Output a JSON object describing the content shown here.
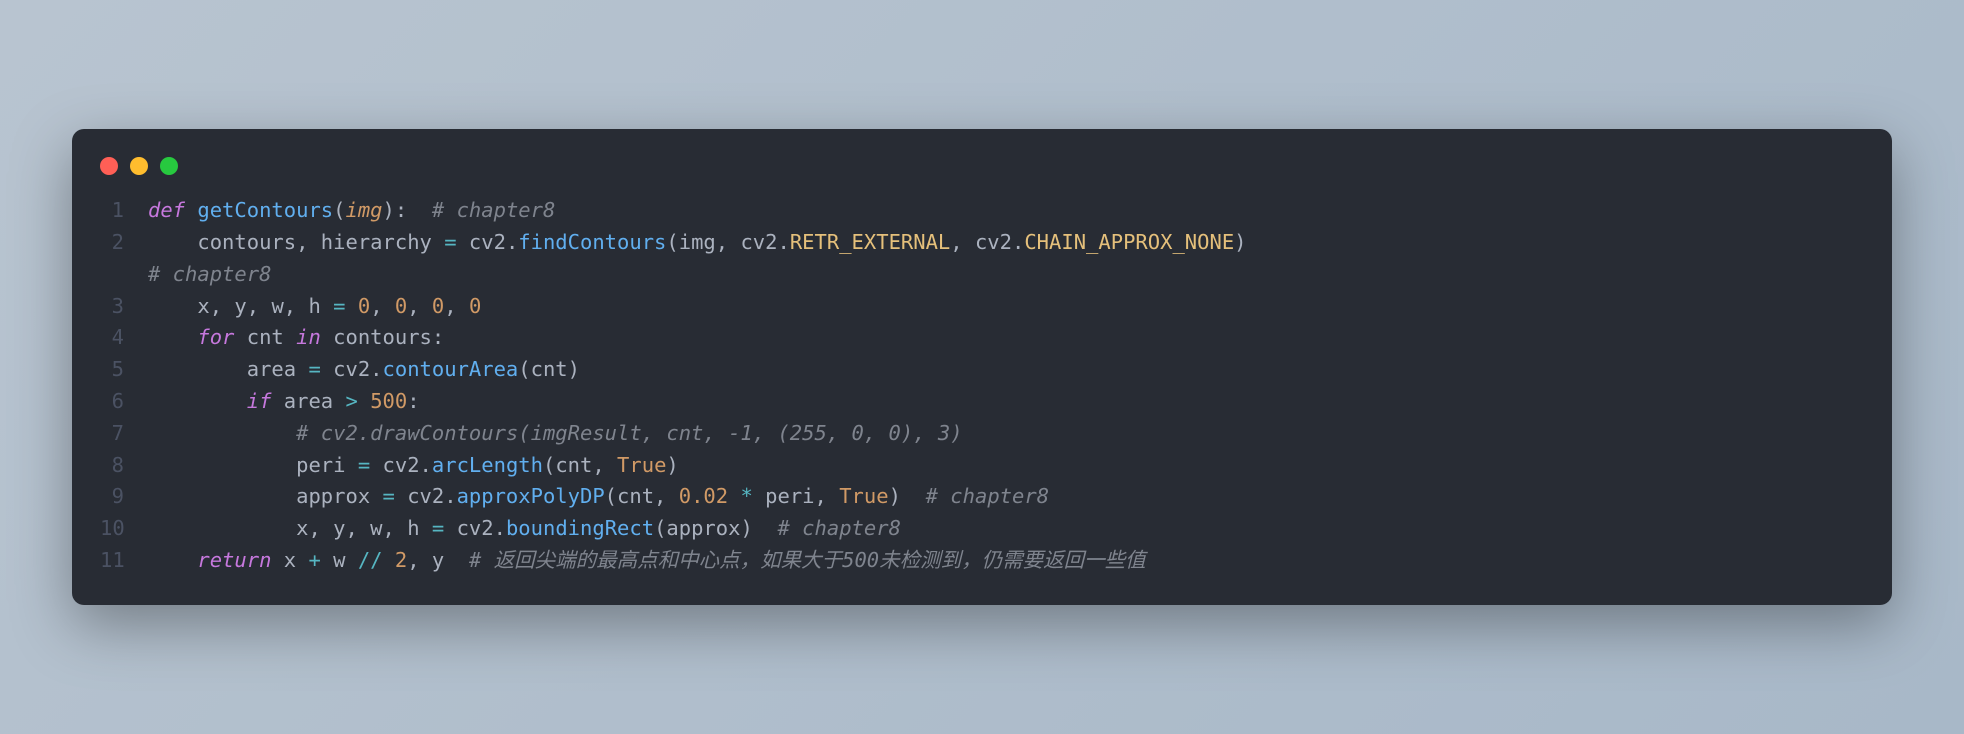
{
  "window": {
    "dots": [
      "red",
      "yellow",
      "green"
    ]
  },
  "lines": [
    {
      "num": "1",
      "tokens": [
        [
          "kw",
          "def "
        ],
        [
          "fn",
          "getContours"
        ],
        [
          "punct",
          "("
        ],
        [
          "param",
          "img"
        ],
        [
          "punct",
          "):  "
        ],
        [
          "comment",
          "# chapter8"
        ]
      ]
    },
    {
      "num": "2",
      "tokens": [
        [
          "ident",
          "    contours"
        ],
        [
          "punct",
          ", "
        ],
        [
          "ident",
          "hierarchy "
        ],
        [
          "op",
          "= "
        ],
        [
          "ident",
          "cv2"
        ],
        [
          "punct",
          "."
        ],
        [
          "fn",
          "findContours"
        ],
        [
          "punct",
          "("
        ],
        [
          "ident",
          "img"
        ],
        [
          "punct",
          ", "
        ],
        [
          "ident",
          "cv2"
        ],
        [
          "punct",
          "."
        ],
        [
          "attr",
          "RETR_EXTERNAL"
        ],
        [
          "punct",
          ", "
        ],
        [
          "ident",
          "cv2"
        ],
        [
          "punct",
          "."
        ],
        [
          "attr",
          "CHAIN_APPROX_NONE"
        ],
        [
          "punct",
          ")  "
        ]
      ]
    },
    {
      "num": "",
      "wrap": true,
      "tokens": [
        [
          "comment",
          "# chapter8"
        ]
      ]
    },
    {
      "num": "3",
      "tokens": [
        [
          "ident",
          "    x"
        ],
        [
          "punct",
          ", "
        ],
        [
          "ident",
          "y"
        ],
        [
          "punct",
          ", "
        ],
        [
          "ident",
          "w"
        ],
        [
          "punct",
          ", "
        ],
        [
          "ident",
          "h "
        ],
        [
          "op",
          "= "
        ],
        [
          "num",
          "0"
        ],
        [
          "punct",
          ", "
        ],
        [
          "num",
          "0"
        ],
        [
          "punct",
          ", "
        ],
        [
          "num",
          "0"
        ],
        [
          "punct",
          ", "
        ],
        [
          "num",
          "0"
        ]
      ]
    },
    {
      "num": "4",
      "tokens": [
        [
          "ident",
          "    "
        ],
        [
          "kw",
          "for "
        ],
        [
          "ident",
          "cnt "
        ],
        [
          "kw",
          "in "
        ],
        [
          "ident",
          "contours"
        ],
        [
          "punct",
          ":"
        ]
      ]
    },
    {
      "num": "5",
      "tokens": [
        [
          "ident",
          "        area "
        ],
        [
          "op",
          "= "
        ],
        [
          "ident",
          "cv2"
        ],
        [
          "punct",
          "."
        ],
        [
          "fn",
          "contourArea"
        ],
        [
          "punct",
          "("
        ],
        [
          "ident",
          "cnt"
        ],
        [
          "punct",
          ")"
        ]
      ]
    },
    {
      "num": "6",
      "tokens": [
        [
          "ident",
          "        "
        ],
        [
          "kw",
          "if "
        ],
        [
          "ident",
          "area "
        ],
        [
          "op",
          "> "
        ],
        [
          "num",
          "500"
        ],
        [
          "punct",
          ":"
        ]
      ]
    },
    {
      "num": "7",
      "tokens": [
        [
          "ident",
          "            "
        ],
        [
          "comment",
          "# cv2.drawContours(imgResult, cnt, -1, (255, 0, 0), 3)"
        ]
      ]
    },
    {
      "num": "8",
      "tokens": [
        [
          "ident",
          "            peri "
        ],
        [
          "op",
          "= "
        ],
        [
          "ident",
          "cv2"
        ],
        [
          "punct",
          "."
        ],
        [
          "fn",
          "arcLength"
        ],
        [
          "punct",
          "("
        ],
        [
          "ident",
          "cnt"
        ],
        [
          "punct",
          ", "
        ],
        [
          "bool",
          "True"
        ],
        [
          "punct",
          ")"
        ]
      ]
    },
    {
      "num": "9",
      "tokens": [
        [
          "ident",
          "            approx "
        ],
        [
          "op",
          "= "
        ],
        [
          "ident",
          "cv2"
        ],
        [
          "punct",
          "."
        ],
        [
          "fn",
          "approxPolyDP"
        ],
        [
          "punct",
          "("
        ],
        [
          "ident",
          "cnt"
        ],
        [
          "punct",
          ", "
        ],
        [
          "num",
          "0.02"
        ],
        [
          "op",
          " * "
        ],
        [
          "ident",
          "peri"
        ],
        [
          "punct",
          ", "
        ],
        [
          "bool",
          "True"
        ],
        [
          "punct",
          ")  "
        ],
        [
          "comment",
          "# chapter8"
        ]
      ]
    },
    {
      "num": "10",
      "tokens": [
        [
          "ident",
          "            x"
        ],
        [
          "punct",
          ", "
        ],
        [
          "ident",
          "y"
        ],
        [
          "punct",
          ", "
        ],
        [
          "ident",
          "w"
        ],
        [
          "punct",
          ", "
        ],
        [
          "ident",
          "h "
        ],
        [
          "op",
          "= "
        ],
        [
          "ident",
          "cv2"
        ],
        [
          "punct",
          "."
        ],
        [
          "fn",
          "boundingRect"
        ],
        [
          "punct",
          "("
        ],
        [
          "ident",
          "approx"
        ],
        [
          "punct",
          ")  "
        ],
        [
          "comment",
          "# chapter8"
        ]
      ]
    },
    {
      "num": "11",
      "tokens": [
        [
          "ident",
          "    "
        ],
        [
          "kw",
          "return "
        ],
        [
          "ident",
          "x "
        ],
        [
          "op",
          "+ "
        ],
        [
          "ident",
          "w "
        ],
        [
          "op",
          "// "
        ],
        [
          "num",
          "2"
        ],
        [
          "punct",
          ", "
        ],
        [
          "ident",
          "y  "
        ],
        [
          "comment",
          "# 返回尖端的最高点和中心点，如果大于500未检测到，仍需要返回一些值"
        ]
      ]
    }
  ]
}
